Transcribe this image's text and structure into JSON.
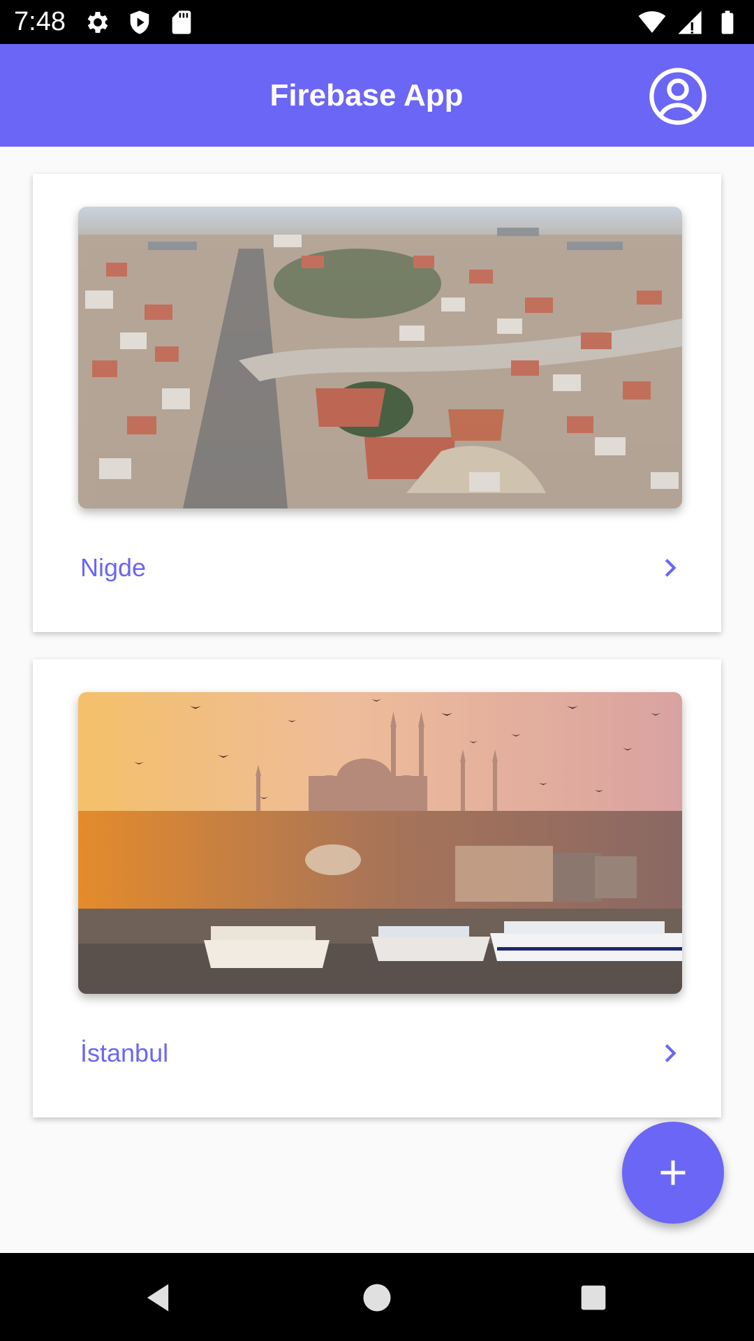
{
  "status_bar": {
    "time": "7:48",
    "left_icons": [
      "settings-icon",
      "play-protect-icon",
      "sd-card-icon"
    ],
    "right_icons": [
      "wifi-icon",
      "cell-signal-icon",
      "battery-icon"
    ]
  },
  "app_bar": {
    "title": "Firebase App",
    "account_icon": "account-circle-icon"
  },
  "cities": [
    {
      "name": "Nigde",
      "image": "aerial city view"
    },
    {
      "name": "İstanbul",
      "image": "istanbul skyline at sunset"
    }
  ],
  "fab": {
    "icon": "plus-icon"
  },
  "nav_bar": {
    "icons": [
      "back-icon",
      "home-icon",
      "recents-icon"
    ]
  },
  "colors": {
    "primary": "#6b66f5",
    "background": "#fafafa",
    "card": "#ffffff",
    "system_bars": "#000000"
  }
}
